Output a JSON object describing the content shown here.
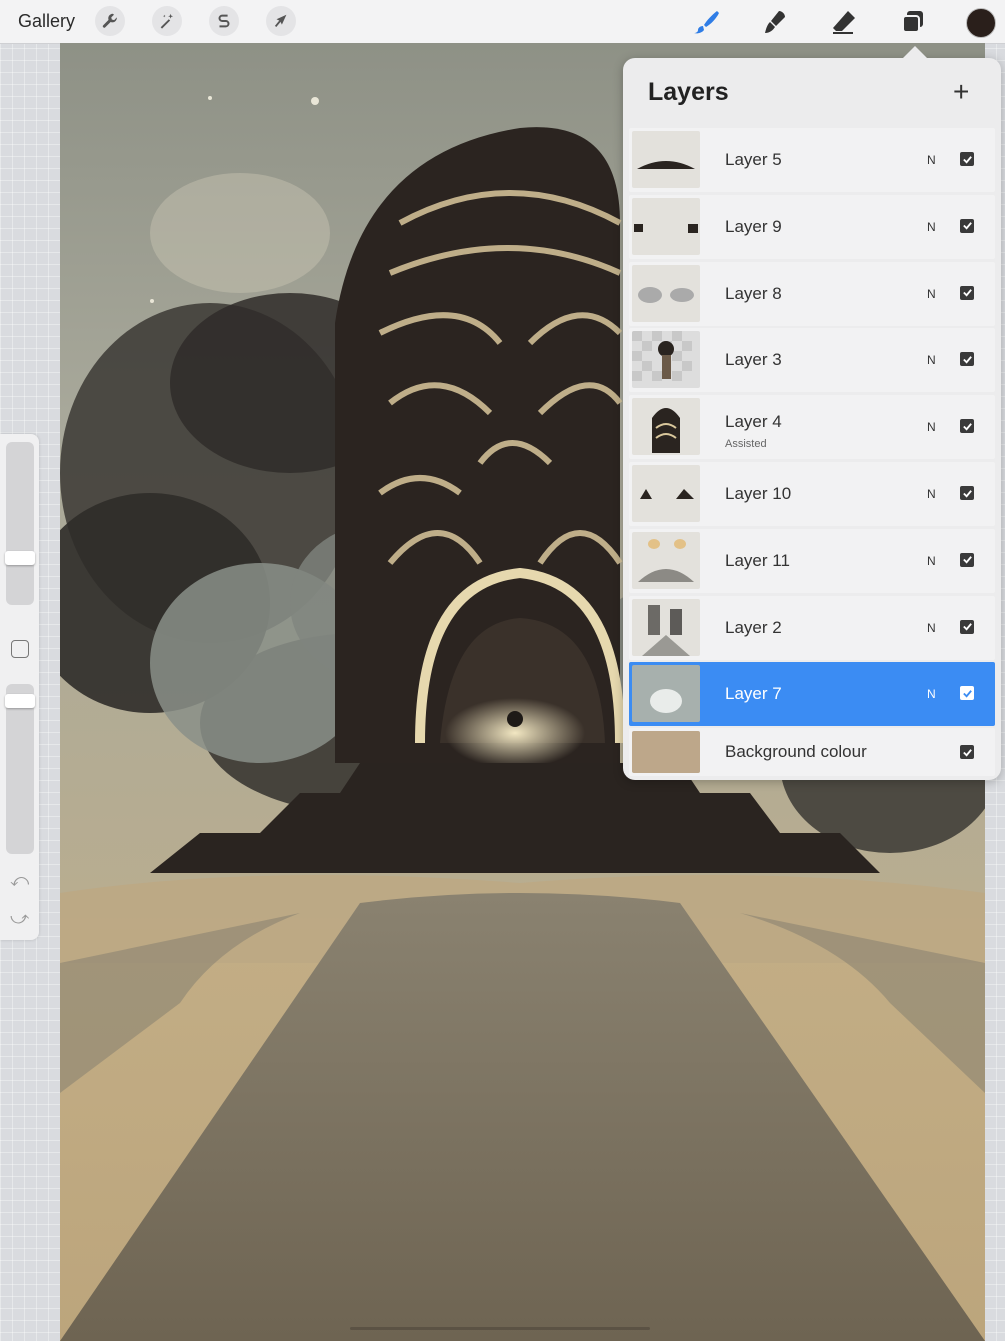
{
  "toolbar": {
    "gallery_label": "Gallery",
    "left_tools": [
      "wrench-icon",
      "magic-wand-icon",
      "selection-s-icon",
      "transform-arrow-icon"
    ],
    "right_tools": [
      "brush-icon",
      "smudge-icon",
      "eraser-icon",
      "layers-icon"
    ],
    "active_tool": "brush-icon",
    "current_color": "#2a1f1b",
    "accent_color": "#3b8cf3"
  },
  "sidebar": {
    "brush_size_level": 0.28,
    "opacity_level": 0.06
  },
  "layers_panel": {
    "title": "Layers",
    "add_label": "+",
    "layers": [
      {
        "name": "Layer 5",
        "sub": "",
        "blend": "N",
        "visible": true,
        "selected": false
      },
      {
        "name": "Layer 9",
        "sub": "",
        "blend": "N",
        "visible": true,
        "selected": false
      },
      {
        "name": "Layer 8",
        "sub": "",
        "blend": "N",
        "visible": true,
        "selected": false
      },
      {
        "name": "Layer 3",
        "sub": "",
        "blend": "N",
        "visible": true,
        "selected": false
      },
      {
        "name": "Layer 4",
        "sub": "Assisted",
        "blend": "N",
        "visible": true,
        "selected": false
      },
      {
        "name": "Layer 10",
        "sub": "",
        "blend": "N",
        "visible": true,
        "selected": false
      },
      {
        "name": "Layer 11",
        "sub": "",
        "blend": "N",
        "visible": true,
        "selected": false
      },
      {
        "name": "Layer 2",
        "sub": "",
        "blend": "N",
        "visible": true,
        "selected": false
      },
      {
        "name": "Layer 7",
        "sub": "",
        "blend": "N",
        "visible": true,
        "selected": true
      }
    ],
    "background": {
      "name": "Background colour",
      "color": "#bda78a",
      "visible": true
    }
  }
}
